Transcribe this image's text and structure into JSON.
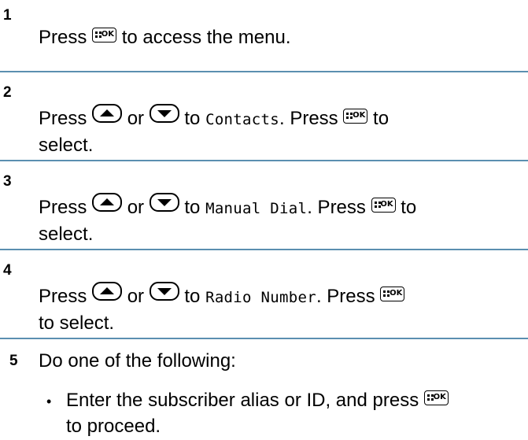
{
  "steps": [
    {
      "number": "1",
      "line1_a": "Press",
      "line1_b": "to access the menu."
    },
    {
      "number": "2",
      "line1_a": "Press",
      "or": "or",
      "to": "to",
      "target": "Contacts",
      "press": ". Press",
      "line1_end": "to",
      "line2": "select."
    },
    {
      "number": "3",
      "line1_a": "Press",
      "or": "or",
      "to": "to",
      "target": "Manual Dial",
      "press": ". Press",
      "line1_end": "to",
      "line2": "select."
    },
    {
      "number": "4",
      "line1_a": "Press",
      "or": "or",
      "to": "to",
      "target": "Radio Number",
      "press": ". Press",
      "line2": "to select."
    },
    {
      "number": "5",
      "text": "Do one of the following:"
    }
  ],
  "bullets": [
    {
      "marker": "•",
      "line1": "Enter the subscriber alias or ID, and press",
      "line2": "to proceed."
    }
  ],
  "icons": {
    "ok_key": "menu-ok-key-icon",
    "ok_label": "OK",
    "up_key": "up-arrow-key-icon",
    "down_key": "down-arrow-key-icon"
  },
  "colors": {
    "rule": "#5b8fb0",
    "text": "#000000"
  }
}
